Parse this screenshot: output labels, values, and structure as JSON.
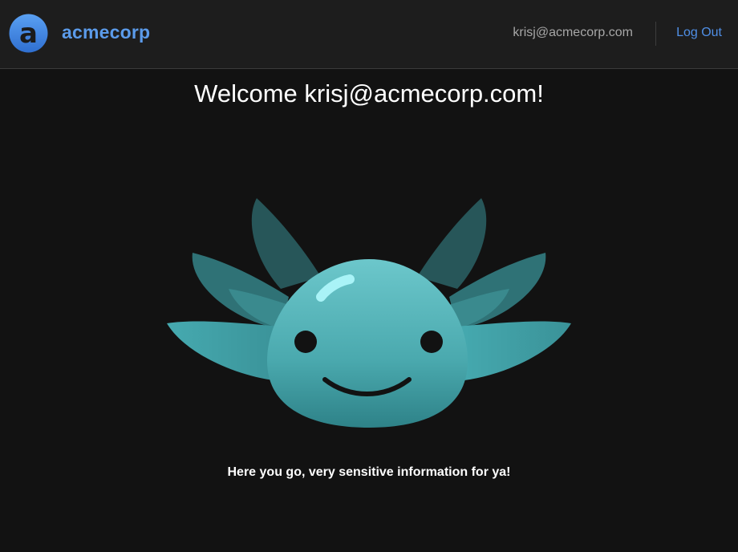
{
  "header": {
    "brand": "acmecorp",
    "logo_letter": "a",
    "user_email": "krisj@acmecorp.com",
    "logout_label": "Log Out"
  },
  "main": {
    "welcome": "Welcome krisj@acmecorp.com!",
    "message": "Here you go, very sensitive information for ya!",
    "mascot_icon": "axolotl-mascot-icon"
  },
  "colors": {
    "brand": "#5b9bea",
    "link": "#4f8fe6",
    "background": "#121212",
    "header_bg": "#1d1d1d",
    "mascot_body": "#4aaeb3"
  }
}
